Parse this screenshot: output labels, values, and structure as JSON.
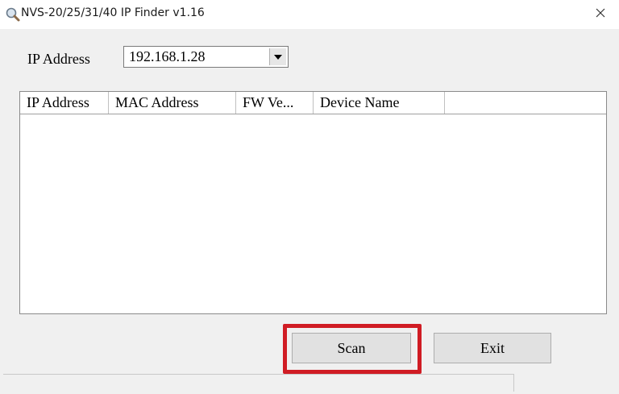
{
  "window": {
    "title": "NVS-20/25/31/40 IP Finder v1.16",
    "app_icon": "magnifier-icon",
    "close_icon": "close-icon"
  },
  "ip_selector": {
    "label": "IP Address",
    "selected_value": "192.168.1.28",
    "dropdown_icon": "dropdown-arrow-icon"
  },
  "device_list": {
    "columns": [
      "IP Address",
      "MAC Address",
      "FW Ve...",
      "Device Name"
    ],
    "rows": []
  },
  "buttons": {
    "scan_label": "Scan",
    "exit_label": "Exit"
  },
  "status_bar": {
    "text": ""
  },
  "colors": {
    "highlight": "#d01c24",
    "background": "#f0f0f0"
  }
}
